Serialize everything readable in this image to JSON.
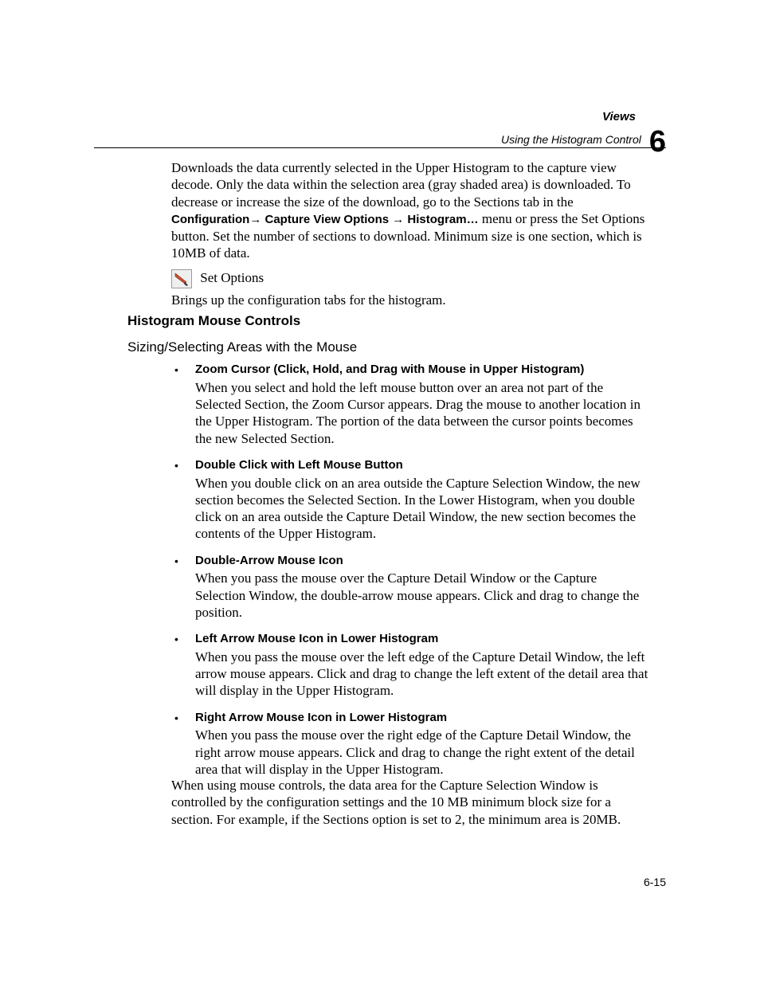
{
  "header": {
    "title": "Views",
    "subtitle": "Using the Histogram Control",
    "chapter_number": "6"
  },
  "intro": {
    "p1a": "Downloads the data currently selected in the Upper Histogram to the capture view decode. Only the data within the selection area (gray shaded area) is downloaded. To decrease or increase the size of the download, go to the Sections tab in the ",
    "menu_config": "Configuration",
    "arrow": "→",
    "menu_cvo": " Capture View Options ",
    "menu_hist": " Histogram…",
    "p1b": " menu or press the Set Options button. Set the number of sections to download. Minimum size is one section, which is 10MB of data.",
    "set_options_label": "Set Options",
    "p2": "Brings up the configuration tabs for the histogram."
  },
  "h2": "Histogram Mouse Controls",
  "h3": "Sizing/Selecting Areas with the Mouse",
  "items": [
    {
      "head": "Zoom Cursor (Click, Hold, and Drag with Mouse in Upper Histogram)",
      "body": "When you select and hold the left mouse button over an area not part of the Selected Section, the Zoom Cursor appears. Drag the mouse to another location in the Upper Histogram. The portion of the data between the cursor points becomes the new Selected Section."
    },
    {
      "head": "Double Click with Left Mouse Button",
      "body": "When you double click on an area outside the Capture Selection Window, the new section becomes the Selected Section. In the Lower Histogram, when you double click on an area outside the Capture Detail Window, the new section becomes the contents of the Upper Histogram."
    },
    {
      "head": "Double-Arrow Mouse Icon",
      "body": "When you pass the mouse over the Capture Detail Window or the Capture Selection Window, the double-arrow mouse appears. Click and drag to change the position."
    },
    {
      "head": "Left Arrow Mouse Icon in Lower Histogram",
      "body": "When you pass the mouse over the left edge of the Capture Detail Window, the left arrow mouse appears. Click and drag to change the left extent of the detail area that will display in the Upper Histogram."
    },
    {
      "head": "Right Arrow Mouse Icon in Lower Histogram",
      "body": "When you pass the mouse over the right edge of the Capture Detail Window, the right arrow mouse appears. Click and drag to change the right extent of the detail area that will display in the Upper Histogram."
    }
  ],
  "closing": "When using mouse controls, the data area for the Capture Selection Window is controlled by the configuration settings and the 10 MB minimum block size for a section. For example, if the Sections option is set to 2, the minimum area is 20MB.",
  "page_number": "6-15"
}
